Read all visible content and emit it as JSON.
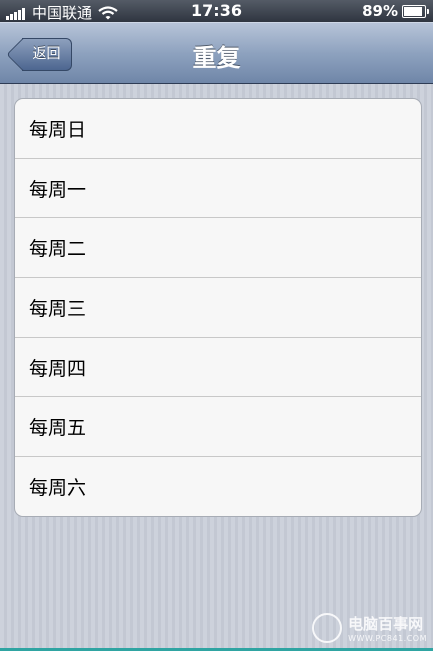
{
  "status_bar": {
    "carrier": "中国联通",
    "time": "17:36",
    "battery": "89%",
    "battery_level": 0.89,
    "signal_icon": "signal-bars-icon",
    "wifi_icon": "wifi-icon"
  },
  "nav": {
    "back_label": "返回",
    "title": "重复"
  },
  "list": {
    "items": [
      {
        "label": "每周日"
      },
      {
        "label": "每周一"
      },
      {
        "label": "每周二"
      },
      {
        "label": "每周三"
      },
      {
        "label": "每周四"
      },
      {
        "label": "每周五"
      },
      {
        "label": "每周六"
      }
    ]
  },
  "watermark": {
    "title": "电脑百事网",
    "url": "WWW.PC841.COM"
  },
  "colors": {
    "nav_bar": "#8ea2bf",
    "status_bar": "#3b414c",
    "list_background": "#f7f7f7",
    "page_background": "#c9ced8"
  }
}
